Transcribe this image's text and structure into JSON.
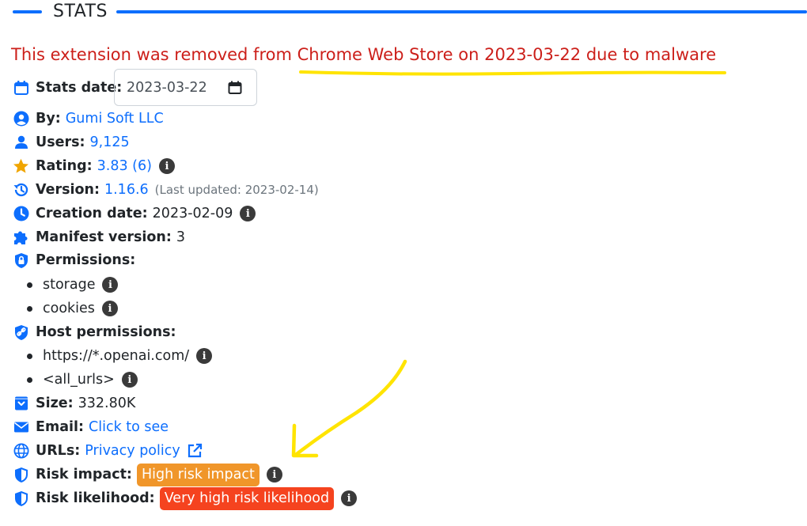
{
  "section": {
    "title": "STATS"
  },
  "notice": "This extension was removed from Chrome Web Store on 2023-03-22 due to malware",
  "stats_date": {
    "label": "Stats date:",
    "value": "2023-03-22"
  },
  "by": {
    "label": "By:",
    "value": "Gumi Soft LLC"
  },
  "users": {
    "label": "Users:",
    "value": "9,125"
  },
  "rating": {
    "label": "Rating:",
    "value": "3.83 (6)"
  },
  "version": {
    "label": "Version:",
    "value": "1.16.6",
    "updated": "(Last updated: 2023-02-14)"
  },
  "creation": {
    "label": "Creation date:",
    "value": "2023-02-09"
  },
  "manifest": {
    "label": "Manifest version:",
    "value": "3"
  },
  "permissions": {
    "label": "Permissions:",
    "items": [
      "storage",
      "cookies"
    ]
  },
  "host_permissions": {
    "label": "Host permissions:",
    "items": [
      "https://*.openai.com/",
      "<all_urls>"
    ]
  },
  "size": {
    "label": "Size:",
    "value": "332.80K"
  },
  "email": {
    "label": "Email:",
    "value": "Click to see"
  },
  "urls": {
    "label": "URLs:",
    "value": "Privacy policy"
  },
  "risk_impact": {
    "label": "Risk impact:",
    "value": "High risk impact",
    "color": "#f0962a"
  },
  "risk_likelihood": {
    "label": "Risk likelihood:",
    "value": "Very high risk likelihood",
    "color": "#f5431f"
  },
  "info_glyph": "i",
  "colors": {
    "accent": "#0d6efd",
    "removed_text": "#cc1f1a",
    "annotation": "#ffe400"
  }
}
